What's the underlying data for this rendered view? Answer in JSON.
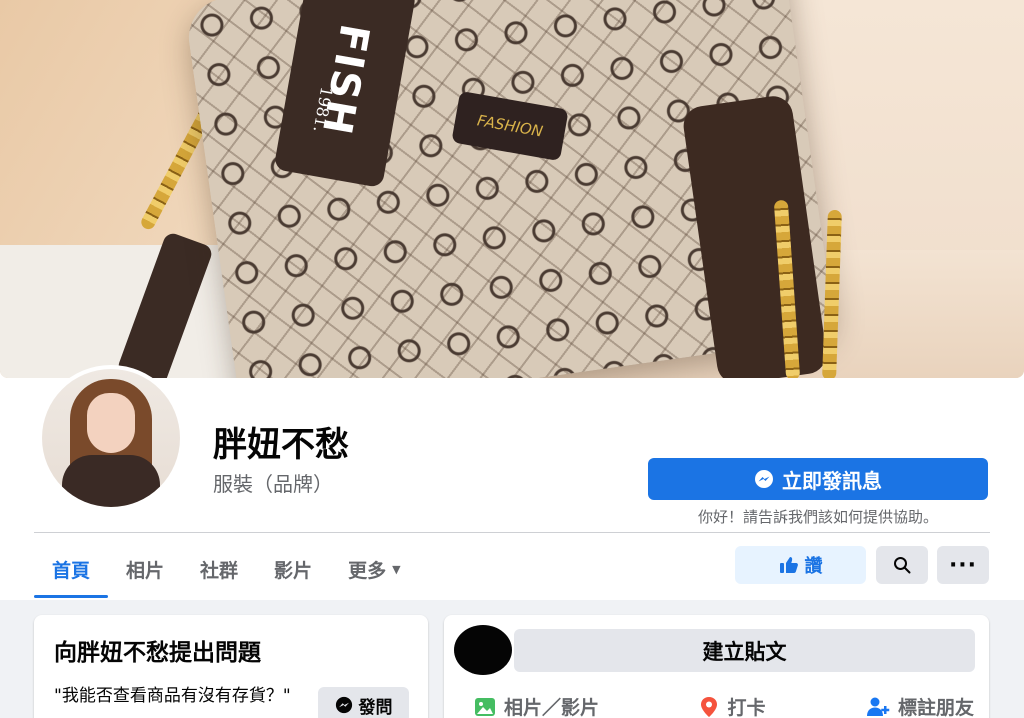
{
  "cover": {
    "strap_text": "FISH",
    "strap_sub": "1981.",
    "patch_text": "FASHION"
  },
  "page": {
    "name": "胖妞不愁",
    "category": "服裝（品牌）"
  },
  "actions": {
    "message_label": "立即發訊息",
    "message_hint": "你好！請告訴我們該如何提供協助。"
  },
  "tabs": [
    {
      "label": "首頁",
      "active": true
    },
    {
      "label": "相片",
      "active": false
    },
    {
      "label": "社群",
      "active": false
    },
    {
      "label": "影片",
      "active": false
    },
    {
      "label": "更多",
      "active": false
    }
  ],
  "toolbar": {
    "like_label": "讚"
  },
  "ask_card": {
    "title": "向胖妞不愁提出問題",
    "question": "\"我能否查看商品有沒有存貨？\"",
    "button_label": "發問"
  },
  "post_card": {
    "create_label": "建立貼文",
    "actions": [
      {
        "label": "相片／影片",
        "icon": "photo-icon"
      },
      {
        "label": "打卡",
        "icon": "location-pin-icon"
      },
      {
        "label": "標註朋友",
        "icon": "tag-friends-icon"
      }
    ]
  },
  "colors": {
    "primary": "#1b74e4",
    "secondary_text": "#65676b",
    "button_gray": "#e4e6eb",
    "like_bg": "#e7f3ff",
    "page_bg": "#f0f2f5"
  }
}
